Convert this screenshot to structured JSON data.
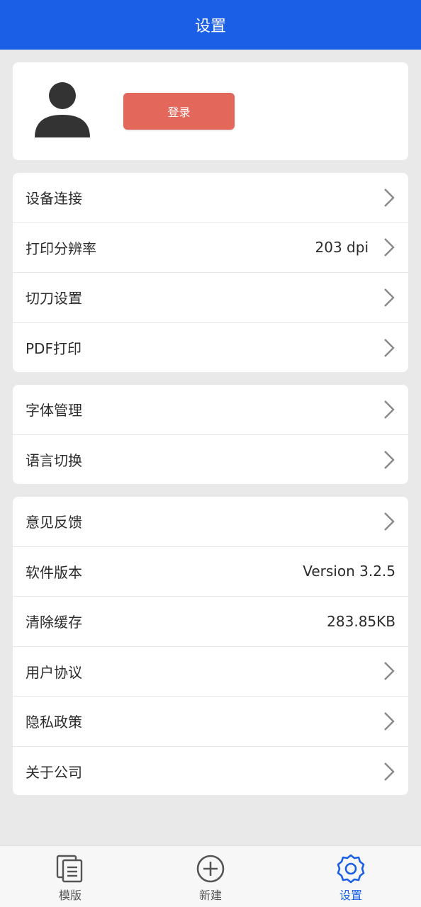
{
  "header": {
    "title": "设置"
  },
  "profile": {
    "login_label": "登录"
  },
  "group1": [
    {
      "label": "设备连接",
      "value": ""
    },
    {
      "label": "打印分辨率",
      "value": "203 dpi"
    },
    {
      "label": "切刀设置",
      "value": ""
    },
    {
      "label": "PDF打印",
      "value": ""
    }
  ],
  "group2": [
    {
      "label": "字体管理"
    },
    {
      "label": "语言切换"
    }
  ],
  "group3": [
    {
      "label": "意见反馈",
      "value": ""
    },
    {
      "label": "软件版本",
      "value": "Version 3.2.5"
    },
    {
      "label": "清除缓存",
      "value": "283.85KB"
    },
    {
      "label": "用户协议",
      "value": ""
    },
    {
      "label": "隐私政策",
      "value": ""
    },
    {
      "label": "关于公司",
      "value": ""
    }
  ],
  "bottom_nav": [
    {
      "label": "模版",
      "icon": "template-icon",
      "active": false
    },
    {
      "label": "新建",
      "icon": "add-circle-icon",
      "active": false
    },
    {
      "label": "设置",
      "icon": "settings-gear-icon",
      "active": true
    }
  ],
  "colors": {
    "primary": "#1a5fe6",
    "login_button": "#e4675b",
    "background": "#e9e9e9"
  }
}
